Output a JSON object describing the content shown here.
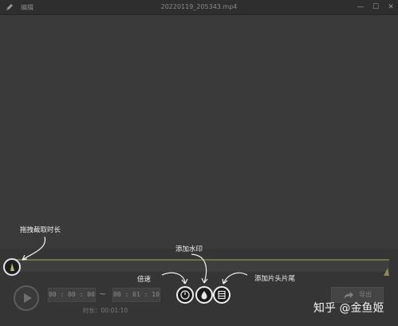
{
  "titlebar": {
    "app_name": "编辑",
    "file_name": "20220119_205343.mp4",
    "minimize_glyph": "—",
    "maximize_glyph": "☐",
    "close_glyph": "✕"
  },
  "icons": {
    "app": "pencil-icon",
    "play": "play-icon",
    "speed": "speed-dial-icon",
    "watermark": "water-drop-icon",
    "head_tail": "film-clip-icon",
    "export": "share-arrow-icon"
  },
  "playback": {
    "start_time": "00 : 00 : 00",
    "separator": "~",
    "end_time": "00 : 01 : 10",
    "duration_label": "时长：00:01:10"
  },
  "export": {
    "label": "导出"
  },
  "annotations": {
    "trim": "拖拽截取时长",
    "watermark": "添加水印",
    "speed": "倍速",
    "head_tail": "添加片头片尾"
  },
  "image_watermark": "知乎 @金鱼姬",
  "colors": {
    "background": "#3a3a3a",
    "timeline_accent": "#6d7148",
    "annotation_text": "#f2f2f2"
  }
}
